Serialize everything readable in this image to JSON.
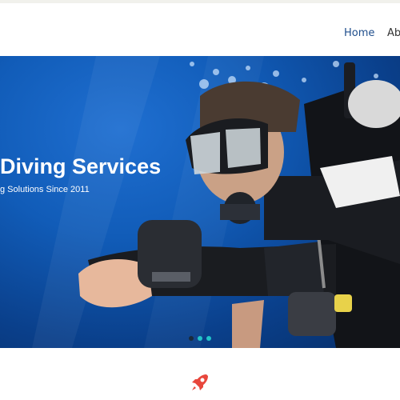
{
  "nav": {
    "items": [
      {
        "label": "Home"
      },
      {
        "label": "Ab"
      }
    ]
  },
  "hero": {
    "title": "Diving Services",
    "subtitle": "g Solutions Since 2011",
    "slides": 3,
    "active_slide": 0
  },
  "feature": {
    "icon": "rocket-icon"
  },
  "colors": {
    "nav_link": "#1f4e8c",
    "hero_bg": "#0a4a9e",
    "dot_active": "#1a2a3a",
    "dot_inactive": "#22c4c8",
    "rocket": "#e8473c"
  }
}
